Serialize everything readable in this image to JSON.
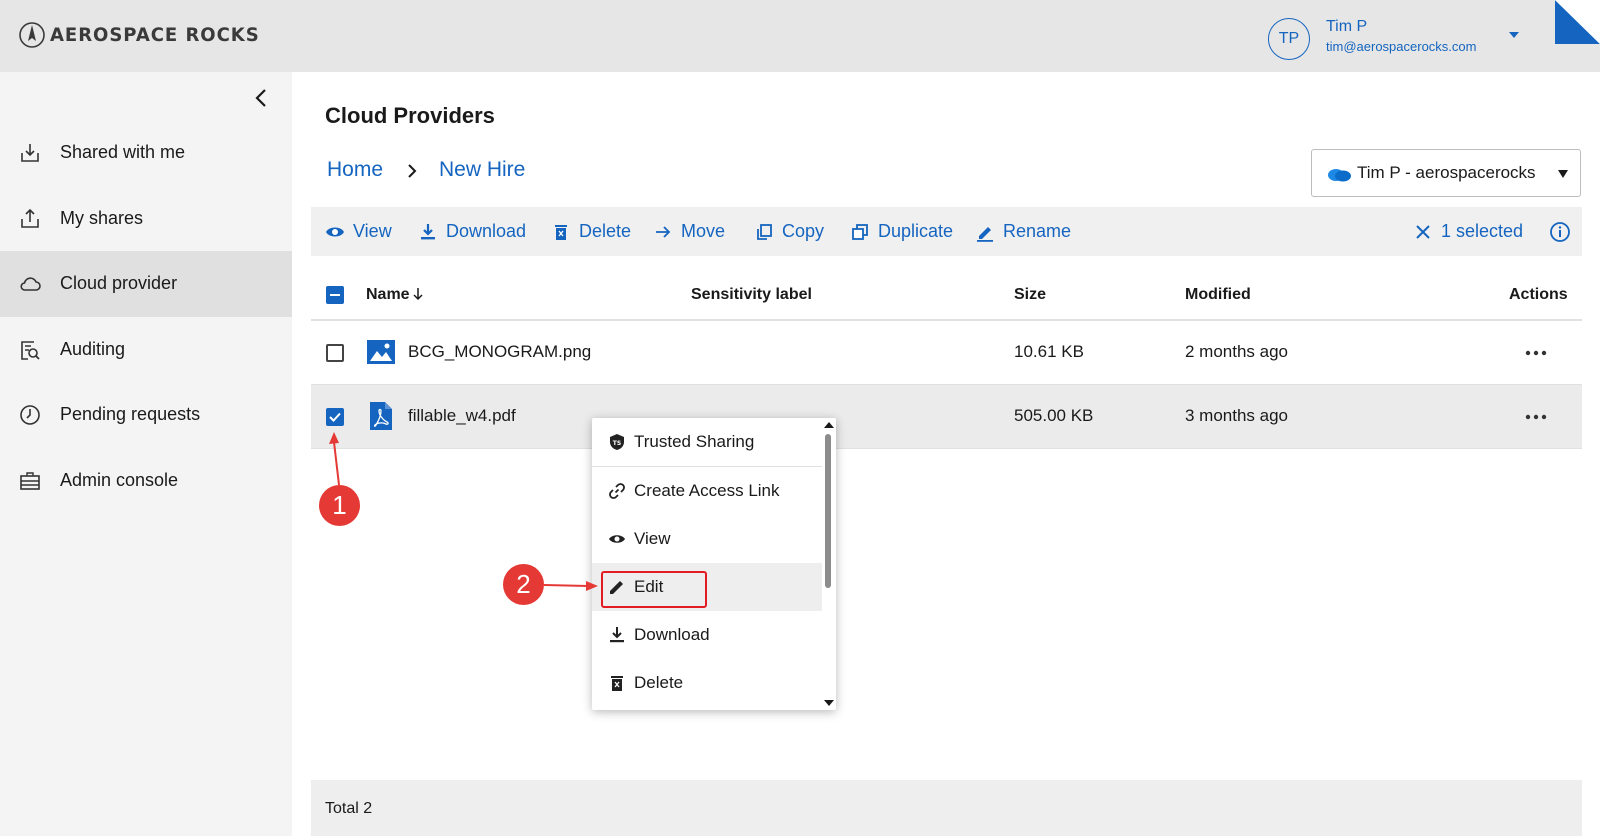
{
  "app": {
    "brand": "AEROSPACE ROCKS"
  },
  "user": {
    "initials": "TP",
    "name": "Tim P",
    "email": "tim@aerospacerocks.com"
  },
  "sidebar": {
    "items": [
      {
        "label": "Shared with me",
        "icon": "inbox-download-icon",
        "active": false
      },
      {
        "label": "My shares",
        "icon": "share-upload-icon",
        "active": false
      },
      {
        "label": "Cloud provider",
        "icon": "cloud-icon",
        "active": true
      },
      {
        "label": "Auditing",
        "icon": "audit-search-icon",
        "active": false
      },
      {
        "label": "Pending requests",
        "icon": "clock-icon",
        "active": false
      },
      {
        "label": "Admin console",
        "icon": "briefcase-icon",
        "active": false
      }
    ]
  },
  "main": {
    "title": "Cloud Providers",
    "breadcrumb": {
      "home": "Home",
      "current": "New Hire"
    },
    "provider_select": {
      "value": "Tim P - aerospacerocks"
    }
  },
  "toolbar": {
    "view": "View",
    "download": "Download",
    "delete": "Delete",
    "move": "Move",
    "copy": "Copy",
    "duplicate": "Duplicate",
    "rename": "Rename",
    "selected": "1 selected"
  },
  "table": {
    "headers": {
      "name": "Name",
      "sensitivity": "Sensitivity label",
      "size": "Size",
      "modified": "Modified",
      "actions": "Actions"
    },
    "rows": [
      {
        "name": "BCG_MONOGRAM.png",
        "sensitivity": "",
        "size": "10.61 KB",
        "modified": "2 months ago",
        "checked": false,
        "type": "image"
      },
      {
        "name": "fillable_w4.pdf",
        "sensitivity": "",
        "size": "505.00 KB",
        "modified": "3 months ago",
        "checked": true,
        "type": "pdf"
      }
    ]
  },
  "context_menu": {
    "items": [
      {
        "label": "Trusted Sharing",
        "icon": "trusted-sharing-shield-icon"
      },
      {
        "label": "Create Access Link",
        "icon": "link-icon"
      },
      {
        "label": "View",
        "icon": "eye-icon"
      },
      {
        "label": "Edit",
        "icon": "pencil-icon"
      },
      {
        "label": "Download",
        "icon": "download-icon"
      },
      {
        "label": "Delete",
        "icon": "trash-icon"
      }
    ]
  },
  "annotations": {
    "step1": "1",
    "step2": "2",
    "callout_color": "#e53935"
  },
  "footer": {
    "total": "Total 2"
  },
  "colors": {
    "accent": "#1565c0",
    "topbar": "#e6e6e6",
    "sidebar": "#f4f4f4",
    "sidebar_active": "#e0e0e0"
  }
}
